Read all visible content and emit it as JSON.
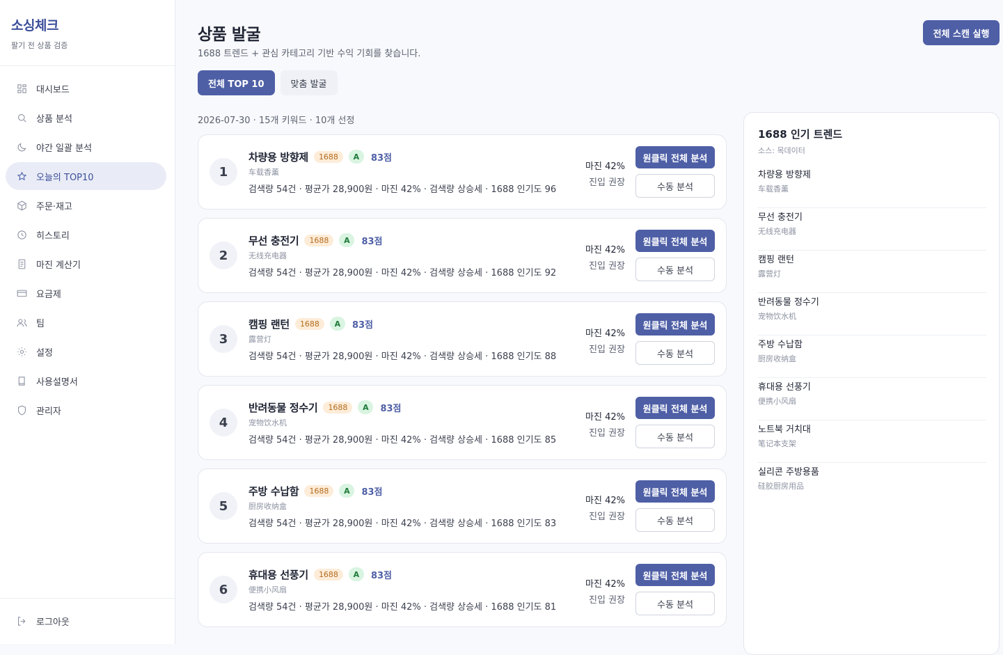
{
  "brand": {
    "title": "소싱체크",
    "subtitle": "팔기 전 상품 검증"
  },
  "nav": [
    {
      "label": "대시보드",
      "icon": "dashboard-icon"
    },
    {
      "label": "상품 분석",
      "icon": "search-icon"
    },
    {
      "label": "야간 일괄 분석",
      "icon": "moon-icon"
    },
    {
      "label": "오늘의 TOP10",
      "icon": "star-icon",
      "active": true
    },
    {
      "label": "주문·재고",
      "icon": "box-icon"
    },
    {
      "label": "히스토리",
      "icon": "clock-icon"
    },
    {
      "label": "마진 계산기",
      "icon": "document-icon"
    },
    {
      "label": "요금제",
      "icon": "card-icon"
    },
    {
      "label": "팀",
      "icon": "users-icon"
    },
    {
      "label": "설정",
      "icon": "gear-icon"
    },
    {
      "label": "사용설명서",
      "icon": "book-icon"
    },
    {
      "label": "관리자",
      "icon": "shield-icon"
    }
  ],
  "logout": "로그아웃",
  "header": {
    "title": "상품 발굴",
    "subtitle": "1688 트렌드 + 관심 카테고리 기반 수익 기회를 찾습니다.",
    "scan_button": "전체 스캔 실행"
  },
  "tabs": [
    {
      "label": "전체 TOP 10",
      "active": true
    },
    {
      "label": "맞춤 발굴",
      "active": false
    }
  ],
  "meta": "2026-07-30 · 15개 키워드 · 10개 선정",
  "products": [
    {
      "rank": "1",
      "name": "차량용 방향제",
      "source_badge": "1688",
      "grade": "A",
      "score": "83점",
      "cn": "车载香薰",
      "stats": "검색량 54건 · 평균가 28,900원 · 마진 42% · 검색량 상승세 · 1688 인기도 96",
      "margin": "마진 42%",
      "advice": "진입 권장",
      "btn_full": "원클릭 전체 분석",
      "btn_manual": "수동 분석"
    },
    {
      "rank": "2",
      "name": "무선 충전기",
      "source_badge": "1688",
      "grade": "A",
      "score": "83점",
      "cn": "无线充电器",
      "stats": "검색량 54건 · 평균가 28,900원 · 마진 42% · 검색량 상승세 · 1688 인기도 92",
      "margin": "마진 42%",
      "advice": "진입 권장",
      "btn_full": "원클릭 전체 분석",
      "btn_manual": "수동 분석"
    },
    {
      "rank": "3",
      "name": "캠핑 랜턴",
      "source_badge": "1688",
      "grade": "A",
      "score": "83점",
      "cn": "露营灯",
      "stats": "검색량 54건 · 평균가 28,900원 · 마진 42% · 검색량 상승세 · 1688 인기도 88",
      "margin": "마진 42%",
      "advice": "진입 권장",
      "btn_full": "원클릭 전체 분석",
      "btn_manual": "수동 분석"
    },
    {
      "rank": "4",
      "name": "반려동물 정수기",
      "source_badge": "1688",
      "grade": "A",
      "score": "83점",
      "cn": "宠物饮水机",
      "stats": "검색량 54건 · 평균가 28,900원 · 마진 42% · 검색량 상승세 · 1688 인기도 85",
      "margin": "마진 42%",
      "advice": "진입 권장",
      "btn_full": "원클릭 전체 분석",
      "btn_manual": "수동 분석"
    },
    {
      "rank": "5",
      "name": "주방 수납함",
      "source_badge": "1688",
      "grade": "A",
      "score": "83점",
      "cn": "厨房收纳盒",
      "stats": "검색량 54건 · 평균가 28,900원 · 마진 42% · 검색량 상승세 · 1688 인기도 83",
      "margin": "마진 42%",
      "advice": "진입 권장",
      "btn_full": "원클릭 전체 분석",
      "btn_manual": "수동 분석"
    },
    {
      "rank": "6",
      "name": "휴대용 선풍기",
      "source_badge": "1688",
      "grade": "A",
      "score": "83점",
      "cn": "便携小风扇",
      "stats": "검색량 54건 · 평균가 28,900원 · 마진 42% · 검색량 상승세 · 1688 인기도 81",
      "margin": "마진 42%",
      "advice": "진입 권장",
      "btn_full": "원클릭 전체 분석",
      "btn_manual": "수동 분석"
    }
  ],
  "trends": {
    "title": "1688 인기 트렌드",
    "source": "소스: 목데이터",
    "items": [
      {
        "name": "차량용 방향제",
        "cn": "车载香薰"
      },
      {
        "name": "무선 충전기",
        "cn": "无线充电器"
      },
      {
        "name": "캠핑 랜턴",
        "cn": "露营灯"
      },
      {
        "name": "반려동물 정수기",
        "cn": "宠物饮水机"
      },
      {
        "name": "주방 수납함",
        "cn": "厨房收纳盒"
      },
      {
        "name": "휴대용 선풍기",
        "cn": "便携小风扇"
      },
      {
        "name": "노트북 거치대",
        "cn": "笔记本支架"
      },
      {
        "name": "실리콘 주방용품",
        "cn": "硅胶厨房用品"
      }
    ]
  },
  "colors": {
    "accent": "#4e5fa6",
    "brand": "#3d4f9a",
    "badge_1688_bg": "#fdecd8",
    "grade_bg": "#d9f4e1"
  }
}
